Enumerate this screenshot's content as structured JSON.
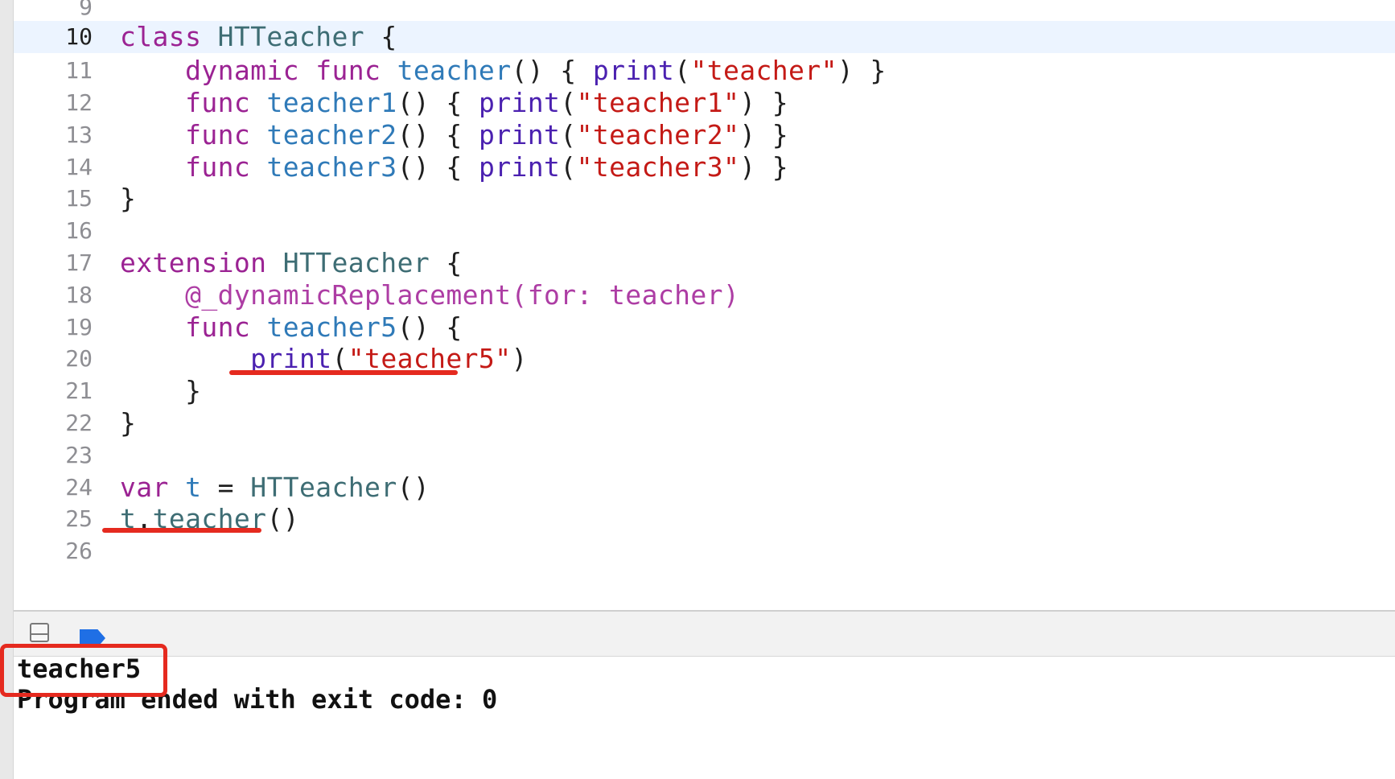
{
  "editor": {
    "current_line": "10",
    "lines": [
      {
        "num": "9",
        "tokens": []
      },
      {
        "num": "10",
        "tokens": [
          {
            "t": "class",
            "c": "kw"
          },
          {
            "t": " ",
            "c": "plain"
          },
          {
            "t": "HTTeacher",
            "c": "type"
          },
          {
            "t": " {",
            "c": "plain"
          }
        ]
      },
      {
        "num": "11",
        "tokens": [
          {
            "t": "    ",
            "c": "plain"
          },
          {
            "t": "dynamic",
            "c": "kw"
          },
          {
            "t": " ",
            "c": "plain"
          },
          {
            "t": "func",
            "c": "kw"
          },
          {
            "t": " ",
            "c": "plain"
          },
          {
            "t": "teacher",
            "c": "fn"
          },
          {
            "t": "() { ",
            "c": "plain"
          },
          {
            "t": "print",
            "c": "call"
          },
          {
            "t": "(",
            "c": "plain"
          },
          {
            "t": "\"teacher\"",
            "c": "str"
          },
          {
            "t": ") }",
            "c": "plain"
          }
        ]
      },
      {
        "num": "12",
        "tokens": [
          {
            "t": "    ",
            "c": "plain"
          },
          {
            "t": "func",
            "c": "kw"
          },
          {
            "t": " ",
            "c": "plain"
          },
          {
            "t": "teacher1",
            "c": "fn"
          },
          {
            "t": "() { ",
            "c": "plain"
          },
          {
            "t": "print",
            "c": "call"
          },
          {
            "t": "(",
            "c": "plain"
          },
          {
            "t": "\"teacher1\"",
            "c": "str"
          },
          {
            "t": ") }",
            "c": "plain"
          }
        ]
      },
      {
        "num": "13",
        "tokens": [
          {
            "t": "    ",
            "c": "plain"
          },
          {
            "t": "func",
            "c": "kw"
          },
          {
            "t": " ",
            "c": "plain"
          },
          {
            "t": "teacher2",
            "c": "fn"
          },
          {
            "t": "() { ",
            "c": "plain"
          },
          {
            "t": "print",
            "c": "call"
          },
          {
            "t": "(",
            "c": "plain"
          },
          {
            "t": "\"teacher2\"",
            "c": "str"
          },
          {
            "t": ") }",
            "c": "plain"
          }
        ]
      },
      {
        "num": "14",
        "tokens": [
          {
            "t": "    ",
            "c": "plain"
          },
          {
            "t": "func",
            "c": "kw"
          },
          {
            "t": " ",
            "c": "plain"
          },
          {
            "t": "teacher3",
            "c": "fn"
          },
          {
            "t": "() { ",
            "c": "plain"
          },
          {
            "t": "print",
            "c": "call"
          },
          {
            "t": "(",
            "c": "plain"
          },
          {
            "t": "\"teacher3\"",
            "c": "str"
          },
          {
            "t": ") }",
            "c": "plain"
          }
        ]
      },
      {
        "num": "15",
        "tokens": [
          {
            "t": "}",
            "c": "plain"
          }
        ]
      },
      {
        "num": "16",
        "tokens": []
      },
      {
        "num": "17",
        "tokens": [
          {
            "t": "extension",
            "c": "kw"
          },
          {
            "t": " ",
            "c": "plain"
          },
          {
            "t": "HTTeacher",
            "c": "type"
          },
          {
            "t": " {",
            "c": "plain"
          }
        ]
      },
      {
        "num": "18",
        "tokens": [
          {
            "t": "    ",
            "c": "plain"
          },
          {
            "t": "@_dynamicReplacement(for: teacher)",
            "c": "attr"
          }
        ]
      },
      {
        "num": "19",
        "tokens": [
          {
            "t": "    ",
            "c": "plain"
          },
          {
            "t": "func",
            "c": "kw"
          },
          {
            "t": " ",
            "c": "plain"
          },
          {
            "t": "teacher5",
            "c": "fn"
          },
          {
            "t": "() {",
            "c": "plain"
          }
        ]
      },
      {
        "num": "20",
        "tokens": [
          {
            "t": "        ",
            "c": "plain"
          },
          {
            "t": "print",
            "c": "call"
          },
          {
            "t": "(",
            "c": "plain"
          },
          {
            "t": "\"teacher5\"",
            "c": "str"
          },
          {
            "t": ")",
            "c": "plain"
          }
        ]
      },
      {
        "num": "21",
        "tokens": [
          {
            "t": "    }",
            "c": "plain"
          }
        ]
      },
      {
        "num": "22",
        "tokens": [
          {
            "t": "}",
            "c": "plain"
          }
        ]
      },
      {
        "num": "23",
        "tokens": []
      },
      {
        "num": "24",
        "tokens": [
          {
            "t": "var",
            "c": "kw"
          },
          {
            "t": " ",
            "c": "plain"
          },
          {
            "t": "t",
            "c": "fn"
          },
          {
            "t": " = ",
            "c": "plain"
          },
          {
            "t": "HTTeacher",
            "c": "type"
          },
          {
            "t": "()",
            "c": "plain"
          }
        ]
      },
      {
        "num": "25",
        "tokens": [
          {
            "t": "t",
            "c": "type"
          },
          {
            "t": ".",
            "c": "plain"
          },
          {
            "t": "teacher",
            "c": "type"
          },
          {
            "t": "()",
            "c": "plain"
          }
        ]
      },
      {
        "num": "26",
        "tokens": []
      }
    ]
  },
  "debug_bar": {
    "console_toggle_icon": "console-toggle-icon",
    "breakpoint_icon": "breakpoint-icon",
    "accent_color": "#1f6fe5"
  },
  "console": {
    "line1": "teacher5",
    "line2": "Program ended with exit code: 0"
  },
  "annotation_color": "#e52a1f"
}
